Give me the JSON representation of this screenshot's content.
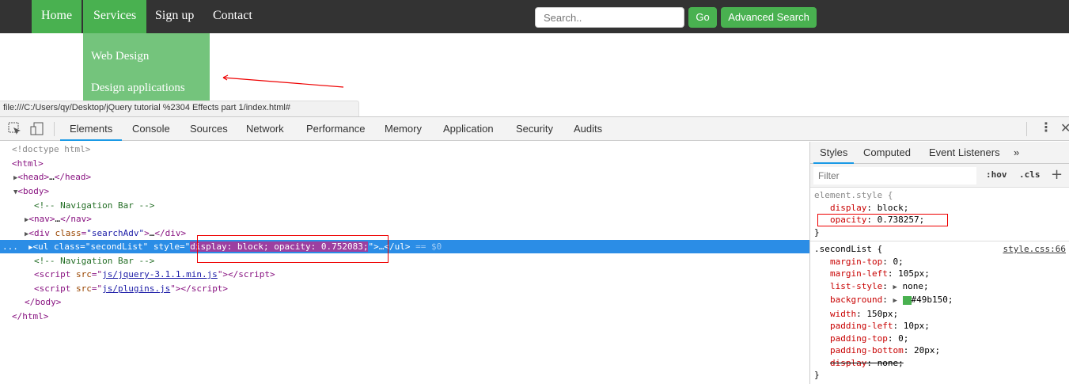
{
  "nav": {
    "items": [
      "Home",
      "Services",
      "Sign up",
      "Contact"
    ],
    "search_placeholder": "Search..",
    "go": "Go",
    "advanced": "Advanced Search"
  },
  "dropdown": {
    "items": [
      "Web Design",
      "Design applications"
    ]
  },
  "status_url": "file:///C:/Users/qy/Desktop/jQuery tutorial %2304 Effects part 1/index.html#",
  "devtools": {
    "tabs": [
      "Elements",
      "Console",
      "Sources",
      "Network",
      "Performance",
      "Memory",
      "Application",
      "Security",
      "Audits"
    ],
    "dom": {
      "doctype": "<!doctype html>",
      "html_open": "<html>",
      "head": "<head>",
      "head_close": "</head>",
      "body": "<body>",
      "comment": "<!-- Navigation Bar -->",
      "nav": "<nav>",
      "nav_close": "</nav>",
      "div_open": "<div ",
      "class_attr": "class",
      "searchadv": "\"searchAdv\"",
      "div_close": "</div>",
      "ul_open": "<ul ",
      "secondlist": "\"secondList\"",
      "style_attr": "style",
      "style_val": "display: block; opacity: 0.752083;",
      "ul_close": "</ul>",
      "eq": "== $0",
      "dots": "...",
      "script_open": "<script ",
      "src_attr": "src",
      "jquery": "js/jquery-3.1.1.min.js",
      "plugins": "js/plugins.js",
      "script_close": "</script>",
      "body_close": "</body>",
      "html_close": "</html>"
    },
    "sidebar": {
      "tabs": [
        "Styles",
        "Computed",
        "Event Listeners",
        "»"
      ],
      "filter_placeholder": "Filter",
      "hov": ":hov",
      "cls": ".cls",
      "plus": "+",
      "element_style": {
        "selector": "element.style {",
        "props": [
          {
            "name": "display",
            "value": "block;"
          },
          {
            "name": "opacity",
            "value": "0.738257;"
          }
        ]
      },
      "secondlist": {
        "selector": ".secondList {",
        "source": "style.css:66",
        "props": [
          {
            "name": "margin-top",
            "value": "0;"
          },
          {
            "name": "margin-left",
            "value": "105px;"
          },
          {
            "name": "list-style",
            "value": "none;",
            "expand": true
          },
          {
            "name": "background",
            "value": "#49b150;",
            "expand": true,
            "color": "#49b150"
          },
          {
            "name": "width",
            "value": "150px;"
          },
          {
            "name": "padding-left",
            "value": "10px;"
          },
          {
            "name": "padding-top",
            "value": "0;"
          },
          {
            "name": "padding-bottom",
            "value": "20px;"
          },
          {
            "name": "display",
            "value": "none;",
            "struck": true
          }
        ]
      },
      "close_brace": "}"
    }
  }
}
